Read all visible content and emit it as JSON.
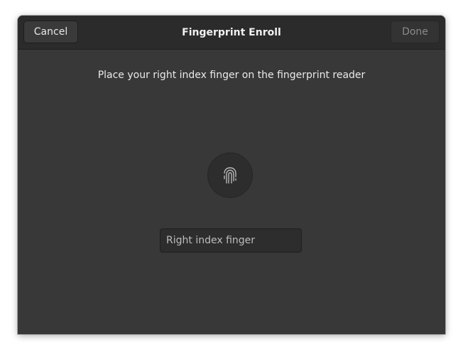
{
  "headerbar": {
    "title": "Fingerprint Enroll",
    "cancel_label": "Cancel",
    "done_label": "Done"
  },
  "main": {
    "instruction": "Place your right index finger on the fingerprint reader",
    "finger_icon": "fingerprint-icon",
    "name_entry": {
      "value": "Right index finger"
    }
  },
  "colors": {
    "window_bg": "#383838",
    "headerbar_bg": "#2b2b2b",
    "text": "#eaeaea"
  }
}
